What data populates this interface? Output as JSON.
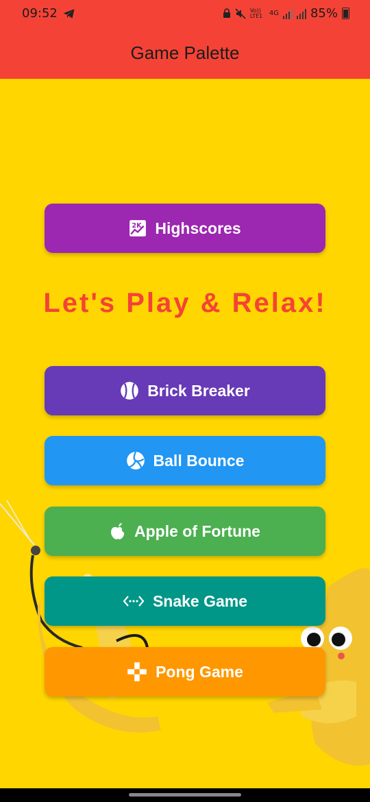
{
  "status_bar": {
    "time": "09:52",
    "battery": "85%",
    "icons": [
      "telegram-icon",
      "lock-icon",
      "mute-icon",
      "volte-icon",
      "4g-icon",
      "signal-icon",
      "signal-icon",
      "battery-icon"
    ],
    "volte_label": "Vo)) LTE1",
    "network_label": "4G"
  },
  "app_bar": {
    "title": "Game Palette"
  },
  "main": {
    "headline": "Let's Play & Relax!",
    "headline_color": "#F44336",
    "buttons": [
      {
        "label": "Highscores",
        "icon": "highscore-icon",
        "color": "#9C27B0"
      },
      {
        "label": "Brick Breaker",
        "icon": "baseball-icon",
        "color": "#673AB7"
      },
      {
        "label": "Ball Bounce",
        "icon": "volleyball-icon",
        "color": "#2196F3"
      },
      {
        "label": "Apple of Fortune",
        "icon": "apple-icon",
        "color": "#4CAF50"
      },
      {
        "label": "Snake Game",
        "icon": "code-icon",
        "color": "#009688"
      },
      {
        "label": "Pong Game",
        "icon": "gamepad-icon",
        "color": "#FF9800"
      }
    ]
  },
  "colors": {
    "app_bar": "#F44336",
    "background": "#FFD600"
  }
}
